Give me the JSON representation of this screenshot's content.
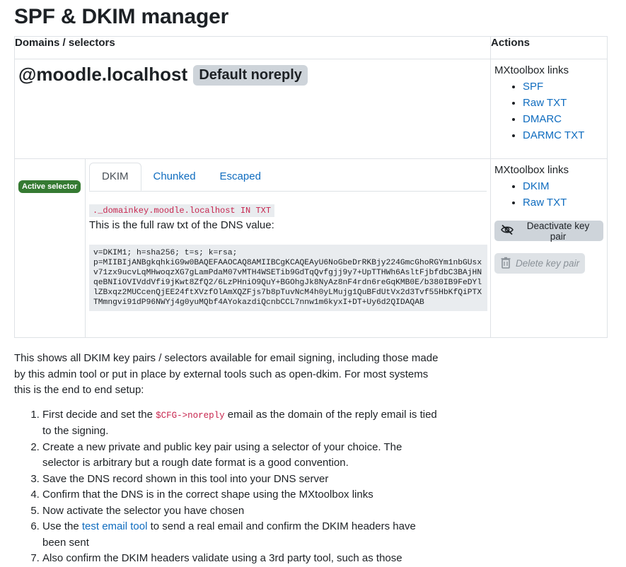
{
  "page_title": "SPF & DKIM manager",
  "table": {
    "col_domains": "Domains / selectors",
    "col_actions": "Actions"
  },
  "domain": {
    "name": "@moodle.localhost",
    "badge": "Default noreply",
    "links_label": "MXtoolbox links",
    "links": [
      "SPF",
      "Raw TXT",
      "DMARC",
      "DARMC TXT"
    ]
  },
  "selector": {
    "badge": "Active selector",
    "tabs": [
      "DKIM",
      "Chunked",
      "Escaped"
    ],
    "active_tab": "DKIM",
    "dns_name": "._domainkey.moodle.localhost IN TXT",
    "raw_desc": "This is the full raw txt of the DNS value:",
    "raw_value": "v=DKIM1; h=sha256; t=s; k=rsa;\np=MIIBIjANBgkqhkiG9w0BAQEFAAOCAQ8AMIIBCgKCAQEAyU6NoGbeDrRKBjy224GmcGhoRGYm1nbGUsxv71zx9ucvLqMHwoqzXG7gLamPdaM07vMTH4WSETib9GdTqQvfgjj9y7+UpTTHWh6AsltFjbfdbC3BAjHNqeBNIiOVIVddVfi9jKwt8ZfQ2/6LzPHniO9QuY+BGOhgJk8NyAz8nF4rdn6reGqKMB0E/b380IB9FeDYllZBxqz2MUCcenQjEE24ftXVzfOlAmXQZFjs7b8pTuvNcM4h0yLMujg1QuBFdUtVx2d3Tvf55HbKfQiPTXTMmngvi91dP96NWYj4g0yuMQbf4AYokazdiQcnbCCL7nnw1m6kyxI+DT+Uy6d2QIDAQAB",
    "links_label": "MXtoolbox links",
    "links": [
      "DKIM",
      "Raw TXT"
    ],
    "deactivate_label": "Deactivate key pair",
    "delete_label": "Delete key pair"
  },
  "intro": "This shows all DKIM key pairs / selectors available for email signing, including those made by this admin tool or put in place by external tools such as open-dkim. For most systems this is the end to end setup:",
  "steps": {
    "s1_pre": "First decide and set the ",
    "s1_code": "$CFG->noreply",
    "s1_post": " email as the domain of the reply email is tied to the signing.",
    "s2": "Create a new private and public key pair using a selector of your choice. The selector is arbitrary but a rough date format is a good convention.",
    "s3": "Save the DNS record shown in this tool into your DNS server",
    "s4": "Confirm that the DNS is in the correct shape using the MXtoolbox links",
    "s5": "Now activate the selector you have chosen",
    "s6_pre": "Use the ",
    "s6_link": "test email tool",
    "s6_post": " to send a real email and confirm the DKIM headers have been sent",
    "s7": "Also confirm the DKIM headers validate using a 3rd party tool, such as those"
  },
  "icons": {
    "deactivate": "eye-slash-icon",
    "delete": "trash-icon"
  },
  "colors": {
    "link": "#0f6cbf",
    "active_badge": "#357a32",
    "code": "#c7254e"
  }
}
